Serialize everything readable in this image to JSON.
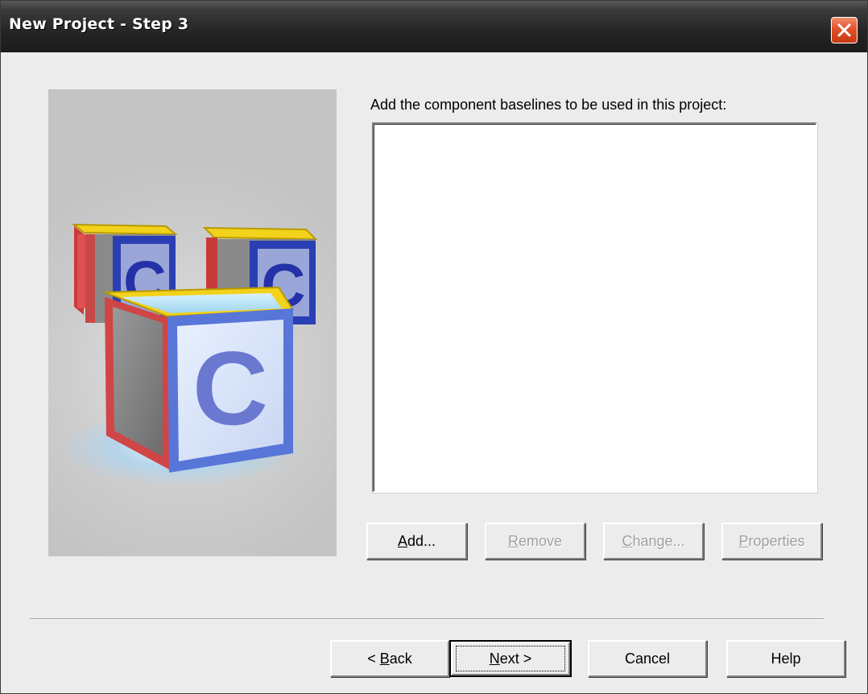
{
  "window": {
    "title": "New Project - Step 3"
  },
  "content": {
    "prompt": "Add the component baselines to be used in this project:",
    "baselines": []
  },
  "list_buttons": {
    "add": {
      "prefix": "",
      "accel": "A",
      "rest": "dd..."
    },
    "remove": {
      "prefix": "",
      "accel": "R",
      "rest": "emove"
    },
    "change": {
      "prefix": "",
      "accel": "C",
      "rest": "hange..."
    },
    "properties": {
      "prefix": "",
      "accel": "P",
      "rest": "roperties"
    }
  },
  "footer_buttons": {
    "back": {
      "prefix": "< ",
      "accel": "B",
      "rest": "ack"
    },
    "next": {
      "prefix": "",
      "accel": "N",
      "rest": "ext >"
    },
    "cancel": "Cancel",
    "help": "Help"
  },
  "illustration": {
    "block_letter": "C"
  },
  "colors": {
    "titlebar": "#2a2a2a",
    "close_button": "#d9481f",
    "dialog_background": "#ececec",
    "disabled_text": "#a0a0a0"
  }
}
